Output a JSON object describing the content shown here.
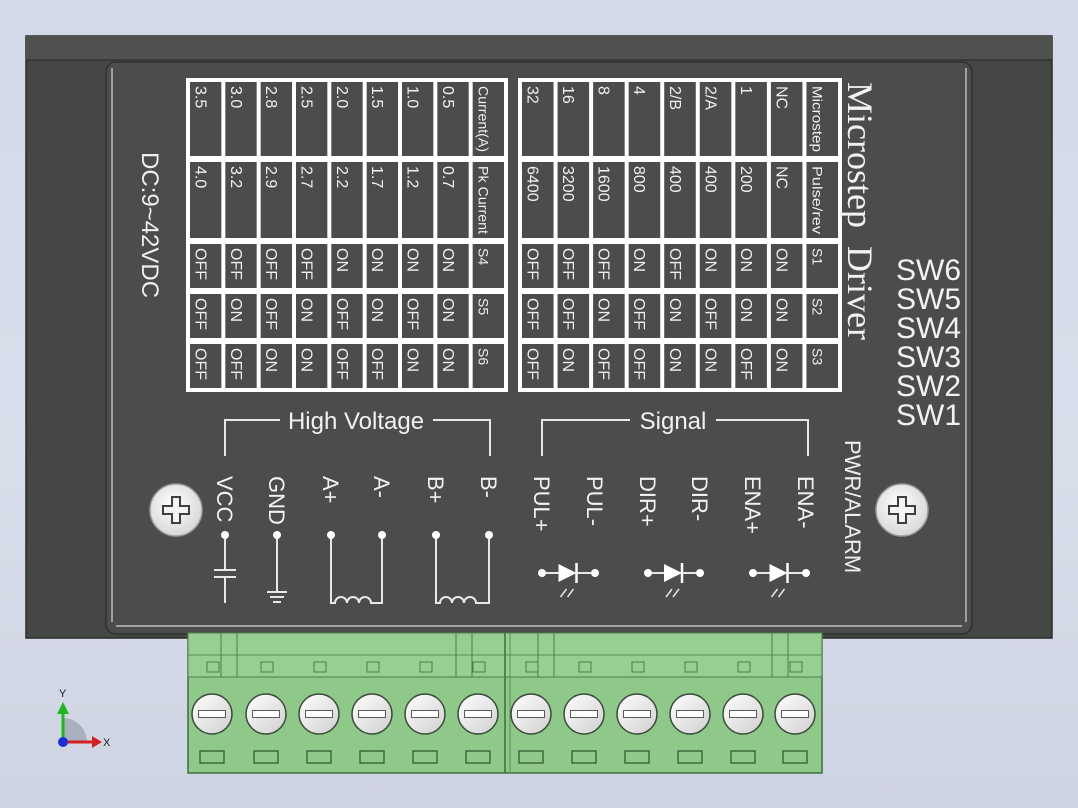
{
  "brand": {
    "line1": "Microstep",
    "line2": "Driver"
  },
  "power_label": "DC:9~42VDC",
  "sw_labels": [
    "SW6",
    "SW5",
    "SW4",
    "SW3",
    "SW2",
    "SW1"
  ],
  "pwr_alarm_label": "PWR/ALARM",
  "current_table": {
    "header_row": [
      "Current(A)",
      "Pk Current",
      "S4",
      "S5",
      "S6"
    ],
    "rows": [
      [
        "0.5",
        "0.7",
        "ON",
        "ON",
        "ON"
      ],
      [
        "1.0",
        "1.2",
        "ON",
        "OFF",
        "ON"
      ],
      [
        "1.5",
        "1.7",
        "ON",
        "ON",
        "OFF"
      ],
      [
        "2.0",
        "2.2",
        "ON",
        "OFF",
        "OFF"
      ],
      [
        "2.5",
        "2.7",
        "OFF",
        "ON",
        "ON"
      ],
      [
        "2.8",
        "2.9",
        "OFF",
        "OFF",
        "ON"
      ],
      [
        "3.0",
        "3.2",
        "OFF",
        "ON",
        "OFF"
      ],
      [
        "3.5",
        "4.0",
        "OFF",
        "OFF",
        "OFF"
      ]
    ]
  },
  "microstep_table": {
    "header_row": [
      "Microstep",
      "Pulse/rev",
      "S1",
      "S2",
      "S3"
    ],
    "rows": [
      [
        "NC",
        "NC",
        "ON",
        "ON",
        "ON"
      ],
      [
        "1",
        "200",
        "ON",
        "ON",
        "OFF"
      ],
      [
        "2/A",
        "400",
        "ON",
        "OFF",
        "ON"
      ],
      [
        "2/B",
        "400",
        "OFF",
        "ON",
        "ON"
      ],
      [
        "4",
        "800",
        "ON",
        "OFF",
        "OFF"
      ],
      [
        "8",
        "1600",
        "OFF",
        "ON",
        "OFF"
      ],
      [
        "16",
        "3200",
        "OFF",
        "OFF",
        "ON"
      ],
      [
        "32",
        "6400",
        "OFF",
        "OFF",
        "OFF"
      ]
    ]
  },
  "group_labels": {
    "high_voltage": "High Voltage",
    "signal": "Signal"
  },
  "terminals": [
    "VCC",
    "GND",
    "A+",
    "A-",
    "B+",
    "B-",
    "PUL+",
    "PUL-",
    "DIR+",
    "DIR-",
    "ENA+",
    "ENA-"
  ],
  "axis": {
    "x": "X",
    "y": "Y"
  },
  "colors": {
    "body": "#4b4d4a",
    "label_line": "#f2f2f2",
    "connector": "#8fc98a",
    "background": "#d5dae9"
  }
}
